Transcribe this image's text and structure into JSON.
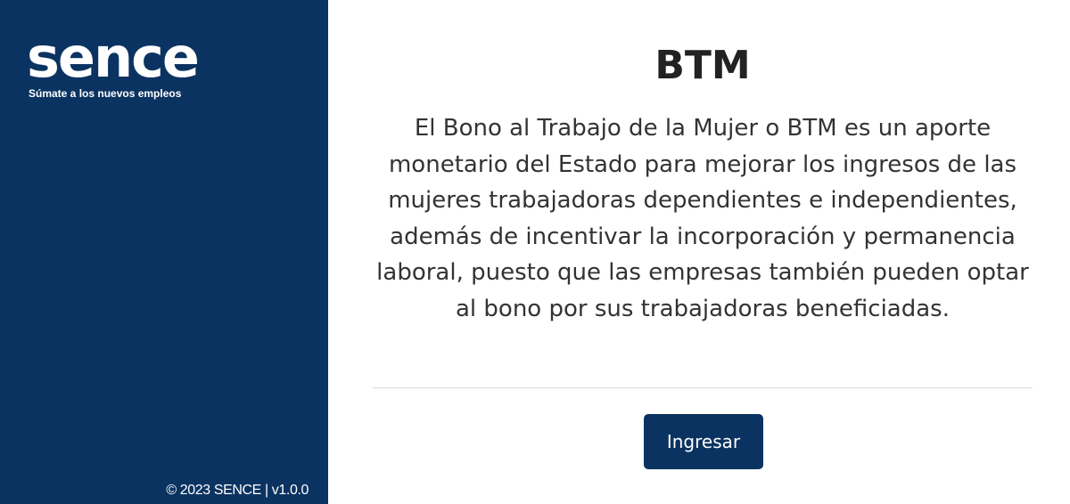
{
  "sidebar": {
    "logo": {
      "text": "sence",
      "tagline": "Súmate a los nuevos empleos"
    },
    "footer": "© 2023 SENCE | v1.0.0"
  },
  "main": {
    "title": "BTM",
    "description": "El Bono al Trabajo de la Mujer o BTM es un aporte monetario del Estado para mejorar los ingresos de las mujeres trabajadoras dependientes e independientes, además de incentivar la incorporación y permanencia laboral, puesto que las empresas también pueden optar al bono por sus trabajadoras beneficiadas.",
    "button_label": "Ingresar"
  },
  "colors": {
    "brand": "#0b3361",
    "background": "#ffffff",
    "text": "#333333"
  }
}
